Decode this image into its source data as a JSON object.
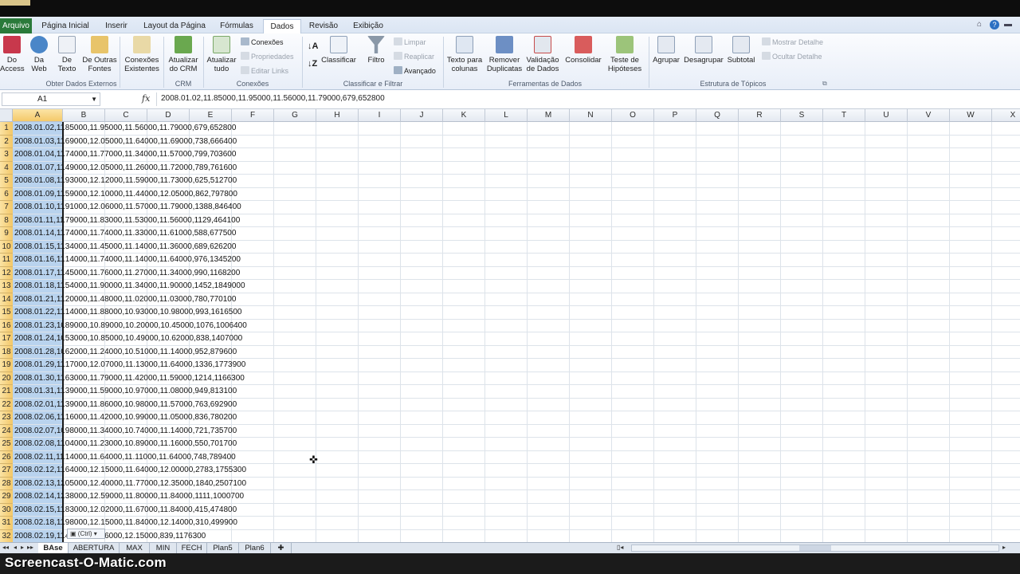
{
  "ribbon_tabs": {
    "file": "Arquivo",
    "items": [
      "Página Inicial",
      "Inserir",
      "Layout da Página",
      "Fórmulas",
      "Dados",
      "Revisão",
      "Exibição"
    ],
    "active": "Dados"
  },
  "ribbon": {
    "groups": {
      "external": "Obter Dados Externos",
      "crm": "CRM",
      "connections": "Conexões",
      "sort": "Classificar e Filtrar",
      "tools": "Ferramentas de Dados",
      "outline": "Estrutura de Tópicos"
    },
    "btn_access": "Do Access",
    "btn_web": "Da Web",
    "btn_text": "De Texto",
    "btn_other": "De Outras Fontes",
    "btn_existing": "Conexões Existentes",
    "btn_crm": "Atualizar do CRM",
    "btn_refresh": "Atualizar tudo",
    "small_connections": "Conexões",
    "small_properties": "Propriedades",
    "small_editlinks": "Editar Links",
    "btn_sort": "Classificar",
    "btn_filter": "Filtro",
    "small_clear": "Limpar",
    "small_reapply": "Reaplicar",
    "small_advanced": "Avançado",
    "btn_textcols": "Texto para colunas",
    "btn_dupes": "Remover Duplicatas",
    "btn_validation": "Validação de Dados",
    "btn_consolidate": "Consolidar",
    "btn_whatif": "Teste de Hipóteses",
    "btn_group": "Agrupar",
    "btn_ungroup": "Desagrupar",
    "btn_subtotal": "Subtotal",
    "small_show": "Mostrar Detalhe",
    "small_hide": "Ocultar Detalhe"
  },
  "formula_bar": {
    "name_box": "A1",
    "fx": "fx",
    "value": "2008.01.02,11.85000,11.95000,11.56000,11.79000,679,652800"
  },
  "columns": [
    "A",
    "B",
    "C",
    "D",
    "E",
    "F",
    "G",
    "H",
    "I",
    "J",
    "K",
    "L",
    "M",
    "N",
    "O",
    "P",
    "Q",
    "R",
    "S",
    "T",
    "U",
    "V",
    "W",
    "X"
  ],
  "rows": [
    {
      "n": "1",
      "a": "2008.01.02,11",
      "rest": ".85000,11.95000,11.56000,11.79000,679,652800"
    },
    {
      "n": "2",
      "a": "2008.01.03,11",
      "rest": ".69000,12.05000,11.64000,11.69000,738,666400"
    },
    {
      "n": "3",
      "a": "2008.01.04,11",
      "rest": ".74000,11.77000,11.34000,11.57000,799,703600"
    },
    {
      "n": "4",
      "a": "2008.01.07,11",
      "rest": ".49000,12.05000,11.26000,11.72000,789,761600"
    },
    {
      "n": "5",
      "a": "2008.01.08,11",
      "rest": ".93000,12.12000,11.59000,11.73000,625,512700"
    },
    {
      "n": "6",
      "a": "2008.01.09,11",
      "rest": ".59000,12.10000,11.44000,12.05000,862,797800"
    },
    {
      "n": "7",
      "a": "2008.01.10,11",
      "rest": ".91000,12.06000,11.57000,11.79000,1388,846400"
    },
    {
      "n": "8",
      "a": "2008.01.11,11",
      "rest": ".79000,11.83000,11.53000,11.56000,1129,464100"
    },
    {
      "n": "9",
      "a": "2008.01.14,11",
      "rest": ".74000,11.74000,11.33000,11.61000,588,677500"
    },
    {
      "n": "10",
      "a": "2008.01.15,11",
      "rest": ".34000,11.45000,11.14000,11.36000,689,626200"
    },
    {
      "n": "11",
      "a": "2008.01.16,11",
      "rest": ".14000,11.74000,11.14000,11.64000,976,1345200"
    },
    {
      "n": "12",
      "a": "2008.01.17,11",
      "rest": ".45000,11.76000,11.27000,11.34000,990,1168200"
    },
    {
      "n": "13",
      "a": "2008.01.18,11",
      "rest": ".54000,11.90000,11.34000,11.90000,1452,1849000"
    },
    {
      "n": "14",
      "a": "2008.01.21,11",
      "rest": ".20000,11.48000,11.02000,11.03000,780,770100"
    },
    {
      "n": "15",
      "a": "2008.01.22,11",
      "rest": ".14000,11.88000,10.93000,10.98000,993,1616500"
    },
    {
      "n": "16",
      "a": "2008.01.23,10",
      "rest": ".89000,10.89000,10.20000,10.45000,1076,1006400"
    },
    {
      "n": "17",
      "a": "2008.01.24,10",
      "rest": ".53000,10.85000,10.49000,10.62000,838,1407000"
    },
    {
      "n": "18",
      "a": "2008.01.28,10",
      "rest": ".62000,11.24000,10.51000,11.14000,952,879600"
    },
    {
      "n": "19",
      "a": "2008.01.29,11",
      "rest": ".17000,12.07000,11.13000,11.64000,1336,1773900"
    },
    {
      "n": "20",
      "a": "2008.01.30,11",
      "rest": ".63000,11.79000,11.42000,11.59000,1214,1166300"
    },
    {
      "n": "21",
      "a": "2008.01.31,11",
      "rest": ".39000,11.59000,10.97000,11.08000,949,813100"
    },
    {
      "n": "22",
      "a": "2008.02.01,11",
      "rest": ".39000,11.86000,10.98000,11.57000,763,692900"
    },
    {
      "n": "23",
      "a": "2008.02.06,11",
      "rest": ".16000,11.42000,10.99000,11.05000,836,780200"
    },
    {
      "n": "24",
      "a": "2008.02.07,10",
      "rest": ".98000,11.34000,10.74000,11.14000,721,735700"
    },
    {
      "n": "25",
      "a": "2008.02.08,11",
      "rest": ".04000,11.23000,10.89000,11.16000,550,701700"
    },
    {
      "n": "26",
      "a": "2008.02.11,11",
      "rest": ".14000,11.64000,11.11000,11.64000,748,789400"
    },
    {
      "n": "27",
      "a": "2008.02.12,11",
      "rest": ".64000,12.15000,11.64000,12.00000,2783,1755300"
    },
    {
      "n": "28",
      "a": "2008.02.13,12",
      "rest": ".05000,12.40000,11.77000,12.35000,1840,2507100"
    },
    {
      "n": "29",
      "a": "2008.02.14,12",
      "rest": ".38000,12.59000,11.80000,11.84000,1111,1000700"
    },
    {
      "n": "30",
      "a": "2008.02.15,11",
      "rest": ".83000,12.02000,11.67000,11.84000,415,474800"
    },
    {
      "n": "31",
      "a": "2008.02.18,11",
      "rest": ".98000,12.15000,11.84000,12.14000,310,499900"
    },
    {
      "n": "32",
      "a": "2008.02.19,11",
      "rest": ".40000,11.96000,12.15000,839,1176300"
    }
  ],
  "paste_options": "(Ctrl)",
  "sheets": [
    "BAse",
    "ABERTURA",
    "MAX",
    "MIN",
    "FECH",
    "Plan5",
    "Plan6"
  ],
  "active_sheet": "BAse",
  "watermark": "Screencast-O-Matic.com"
}
